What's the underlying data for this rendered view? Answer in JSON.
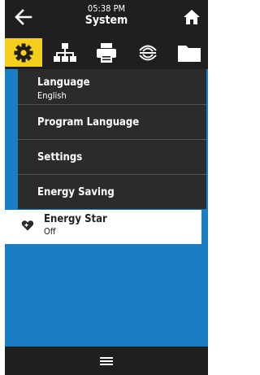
{
  "header": {
    "clock": "05:38 PM",
    "title": "System",
    "back_icon": "arrow-left-icon",
    "home_icon": "home-icon"
  },
  "tabs": [
    {
      "name": "system",
      "icon": "gear-icon",
      "active": true
    },
    {
      "name": "connection",
      "icon": "network-icon",
      "active": false
    },
    {
      "name": "print",
      "icon": "printer-icon",
      "active": false
    },
    {
      "name": "rfid",
      "icon": "rfid-icon",
      "active": false
    },
    {
      "name": "storage",
      "icon": "folder-icon",
      "active": false
    }
  ],
  "submenu": {
    "items": [
      {
        "label": "Language",
        "value": "English"
      },
      {
        "label": "Program Language"
      },
      {
        "label": "Settings"
      },
      {
        "label": "Energy Saving"
      }
    ]
  },
  "energy_star": {
    "label": "Energy Star",
    "value": "Off",
    "icon": "heart-plus-icon"
  },
  "footer": {
    "menu_icon": "hamburger-menu-icon"
  },
  "colors": {
    "background": "#1f1f1f",
    "content": "#1b7ec4",
    "active_tab": "#f5cf1b",
    "submenu": "#2b2b2b"
  }
}
